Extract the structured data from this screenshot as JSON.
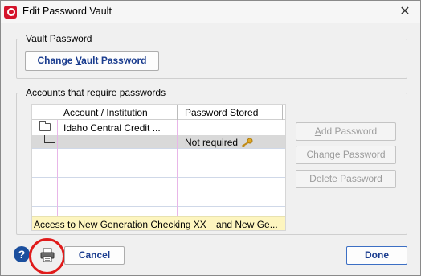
{
  "window": {
    "title": "Edit Password Vault",
    "close_glyph": "✕"
  },
  "vault_group": {
    "legend": "Vault Password",
    "change_button_pre": "Change ",
    "change_button_accel": "V",
    "change_button_post": "ault Password"
  },
  "accounts_group": {
    "legend": "Accounts that require passwords",
    "columns": [
      "Account / Institution",
      "Password Stored"
    ],
    "rows": [
      {
        "account": "Idaho Central Credit ...",
        "password_stored": ""
      },
      {
        "account": "",
        "password_stored": "Not required"
      }
    ],
    "footer_left": "Access to New Generation Checking XX",
    "footer_right": "and New Ge...",
    "buttons": {
      "add": {
        "accel": "A",
        "rest": "dd Password"
      },
      "change": {
        "accel": "C",
        "rest": "hange Password"
      },
      "delete": {
        "accel": "D",
        "rest": "elete Password"
      }
    }
  },
  "footer": {
    "help_glyph": "?",
    "cancel_label": "Cancel",
    "done_label": "Done"
  },
  "icons": {
    "app": "quicken-app-icon",
    "folder": "folder-icon",
    "key": "key-icon",
    "printer": "printer-icon",
    "help": "help-icon"
  },
  "colors": {
    "primary_text": "#1b3d8f",
    "highlight_ring": "#e01b1b",
    "footer_row": "#fdf5bf",
    "selected_row": "#d9d9d9"
  }
}
